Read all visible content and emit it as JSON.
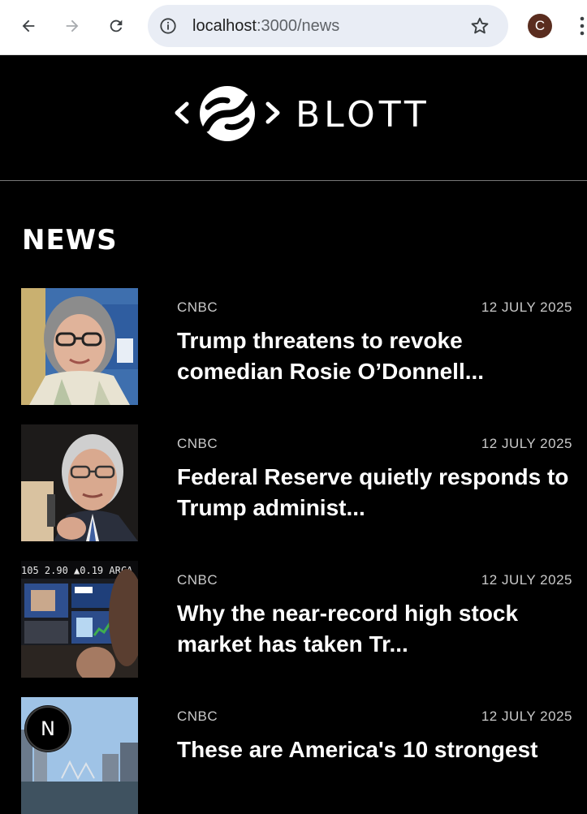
{
  "browser": {
    "url_host": "localhost",
    "url_path": ":3000/news",
    "profile_initial": "C"
  },
  "site": {
    "logo_text": "BLOTT"
  },
  "news": {
    "title": "NEWS",
    "items": [
      {
        "source": "CNBC",
        "date": "12 JULY 2025",
        "headline": "Trump threatens to revoke comedian Rosie O’Donnell..."
      },
      {
        "source": "CNBC",
        "date": "12 JULY 2025",
        "headline": "Federal Reserve quietly responds to Trump administ..."
      },
      {
        "source": "CNBC",
        "date": "12 JULY 2025",
        "headline": "Why the near-record high stock market has taken Tr...",
        "thumb_ticker": "105 2.90 ▲0.19 ARCA"
      },
      {
        "source": "CNBC",
        "date": "12 JULY 2025",
        "headline": "These are America's 10 strongest"
      }
    ]
  },
  "dev_badge": {
    "label": "N"
  },
  "colors": {
    "background": "#000000",
    "text": "#ffffff",
    "meta": "#c9c9c9",
    "divider": "#777777"
  }
}
